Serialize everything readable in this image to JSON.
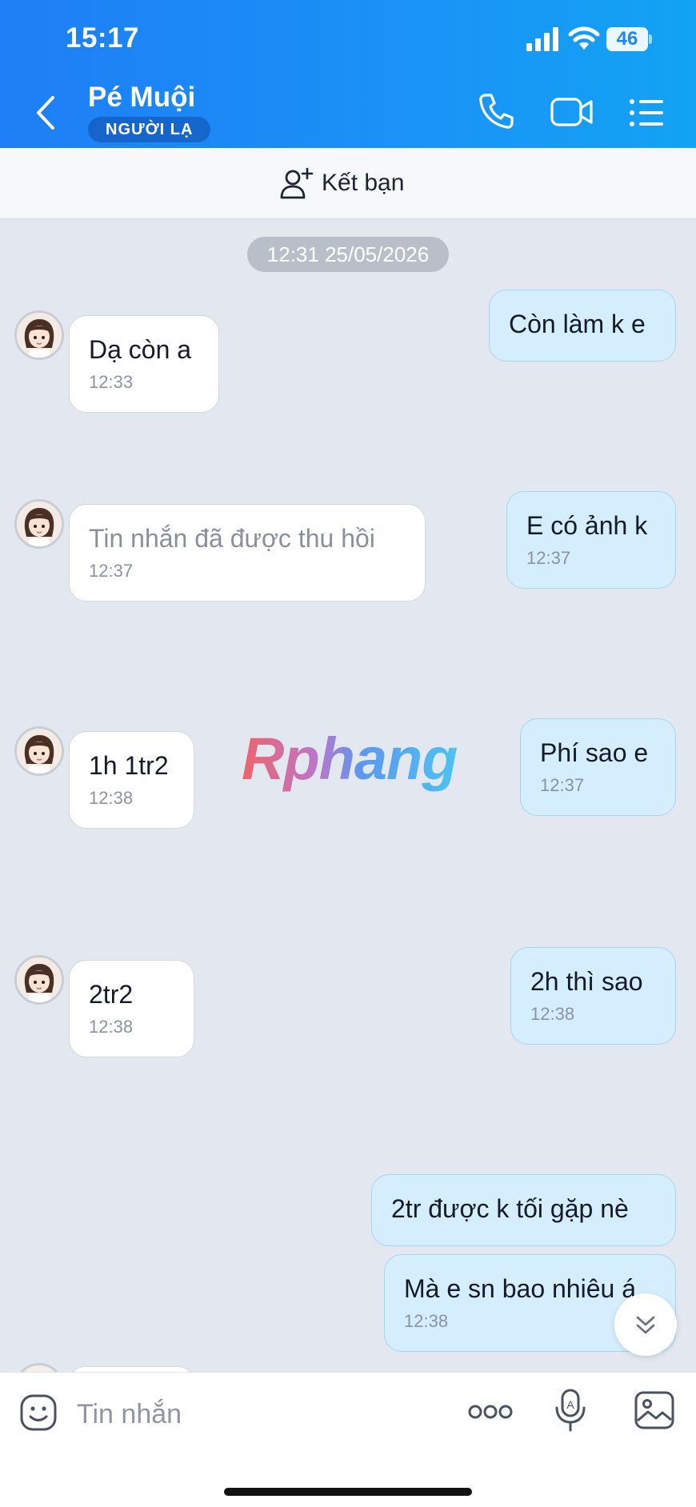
{
  "status_bar": {
    "time": "15:17",
    "battery": "46"
  },
  "header": {
    "contact_name": "Pé Muội",
    "badge": "NGƯỜI LẠ"
  },
  "add_friend": {
    "label": "Kết bạn"
  },
  "chat": {
    "date_divider": "12:31 25/05/2026",
    "watermark": "Rphang",
    "messages": [
      {
        "side": "out",
        "text": "Còn làm k e",
        "time": ""
      },
      {
        "side": "in",
        "text": "Dạ còn a",
        "time": "12:33"
      },
      {
        "side": "out",
        "text": "E có ảnh k",
        "time": "12:37"
      },
      {
        "side": "in",
        "text": "Tin nhắn đã được thu hồi",
        "time": "12:37",
        "recalled": true
      },
      {
        "side": "out",
        "text": "Phí sao e",
        "time": "12:37"
      },
      {
        "side": "in",
        "text": "1h 1tr2",
        "time": "12:38"
      },
      {
        "side": "out",
        "text": "2h thì sao",
        "time": "12:38"
      },
      {
        "side": "in",
        "text": "2tr2",
        "time": "12:38"
      },
      {
        "side": "out",
        "text": "2tr được k tối gặp nè",
        "time": ""
      },
      {
        "side": "out",
        "text": "Mà e sn bao nhiêu á",
        "time": "12:38"
      }
    ]
  },
  "composer": {
    "placeholder": "Tin nhắn"
  },
  "icons": {
    "back": "chevron-left-icon",
    "call": "phone-icon",
    "video": "video-camera-icon",
    "menu": "list-menu-icon",
    "add_friend": "add-person-icon",
    "emoji": "sticker-icon",
    "more": "more-dots-icon",
    "voice": "microphone-icon",
    "image": "image-icon",
    "scroll_down": "double-chevron-down-icon"
  },
  "colors": {
    "header_start": "#1e7ef5",
    "header_end": "#12a3f3",
    "incoming_bubble": "#ffffff",
    "outgoing_bubble": "#d5eefd",
    "chat_background": "#e2e7f0"
  }
}
